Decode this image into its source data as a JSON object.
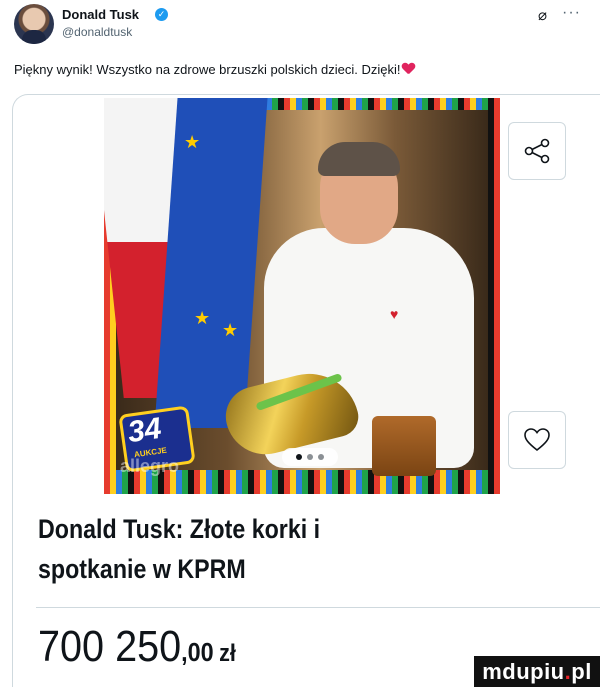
{
  "author": {
    "name": "Donald Tusk",
    "handle": "@donaldtusk"
  },
  "header_icons": [
    "verified-icon",
    "grok-icon",
    "more-icon"
  ],
  "tweet": {
    "text": "Piękny wynik! Wszystko na zdrowe brzuszki polskich dzieci. Dzięki!"
  },
  "card": {
    "image_badge": {
      "number": "34",
      "label": "AUKCJE",
      "brand": "allegro"
    },
    "carousel": {
      "dots": 3,
      "active_index": 0
    },
    "title": "Donald Tusk: Złote korki i spotkanie w KPRM",
    "price": {
      "integer": "700 250",
      "decimal": ",00",
      "currency": "zł"
    },
    "buttons": [
      "share",
      "like"
    ]
  },
  "watermark": {
    "text": "mdupiu",
    "dot": ".",
    "suffix": "pl"
  },
  "colors": {
    "verified": "#1d9bf0",
    "heart": "#e0245e",
    "border": "#cfd9de",
    "secondary_text": "#536471"
  }
}
